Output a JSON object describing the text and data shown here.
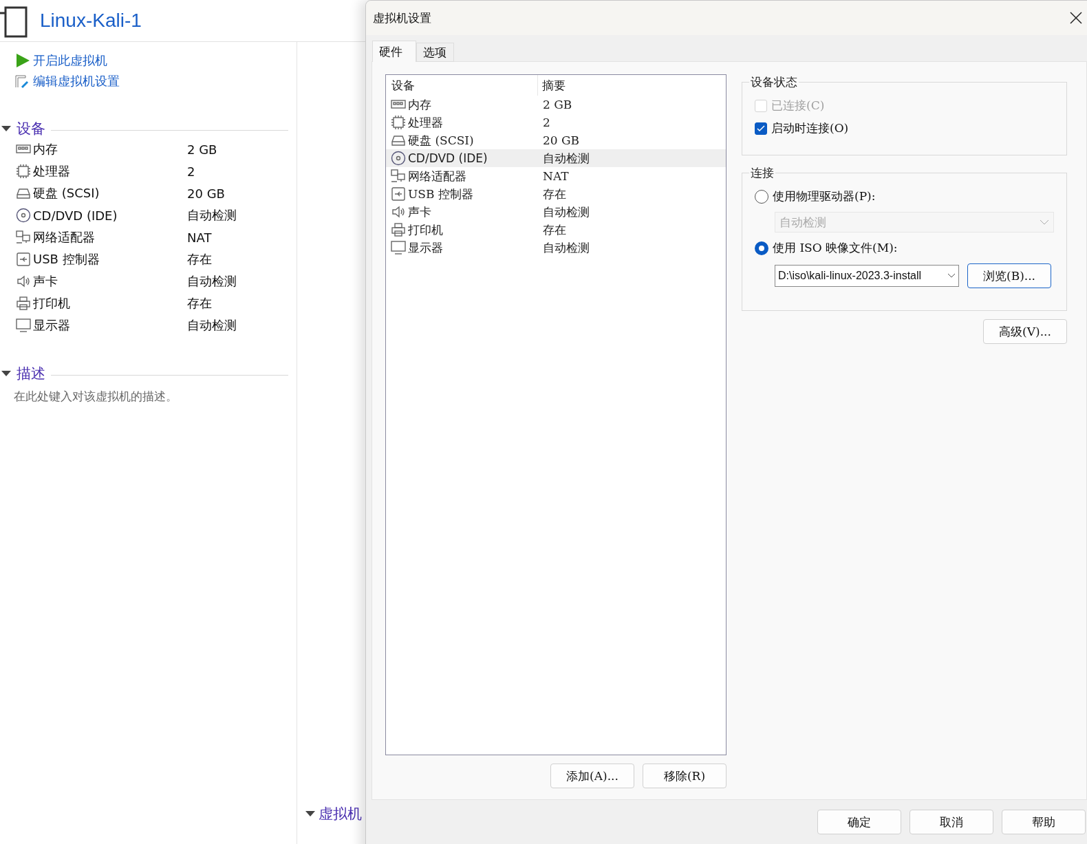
{
  "main_window": {
    "title": "Linux-Kali-1",
    "actions": [
      {
        "kind": "play",
        "label": "开启此虚拟机"
      },
      {
        "kind": "edit",
        "label": "编辑虚拟机设置"
      }
    ],
    "devices_section": {
      "title": "设备",
      "expanded": true,
      "items": [
        {
          "kind": "memory",
          "name": "内存",
          "value": "2 GB"
        },
        {
          "kind": "cpu",
          "name": "处理器",
          "value": "2"
        },
        {
          "kind": "disk",
          "name": "硬盘 (SCSI)",
          "value": "20 GB"
        },
        {
          "kind": "cdrom",
          "name": "CD/DVD (IDE)",
          "value": "自动检测"
        },
        {
          "kind": "network",
          "name": "网络适配器",
          "value": "NAT"
        },
        {
          "kind": "usb",
          "name": "USB 控制器",
          "value": "存在"
        },
        {
          "kind": "sound",
          "name": "声卡",
          "value": "自动检测"
        },
        {
          "kind": "printer",
          "name": "打印机",
          "value": "存在"
        },
        {
          "kind": "display",
          "name": "显示器",
          "value": "自动检测"
        }
      ]
    },
    "description_section": {
      "title": "描述",
      "expanded": true,
      "placeholder": "在此处键入对该虚拟机的描述。"
    },
    "details_section": {
      "title": "虚拟机",
      "expanded": true
    }
  },
  "dialog": {
    "title": "虚拟机设置",
    "tabs": [
      {
        "label": "硬件",
        "selected": true
      },
      {
        "label": "选项",
        "selected": false
      }
    ],
    "device_table": {
      "columns": [
        "设备",
        "摘要"
      ],
      "rows": [
        {
          "kind": "memory",
          "device": "内存",
          "summary": "2 GB",
          "selected": false
        },
        {
          "kind": "cpu",
          "device": "处理器",
          "summary": "2",
          "selected": false
        },
        {
          "kind": "disk",
          "device": "硬盘 (SCSI)",
          "summary": "20 GB",
          "selected": false
        },
        {
          "kind": "cdrom",
          "device": "CD/DVD (IDE)",
          "summary": "自动检测",
          "selected": true
        },
        {
          "kind": "network",
          "device": "网络适配器",
          "summary": "NAT",
          "selected": false
        },
        {
          "kind": "usb",
          "device": "USB 控制器",
          "summary": "存在",
          "selected": false
        },
        {
          "kind": "sound",
          "device": "声卡",
          "summary": "自动检测",
          "selected": false
        },
        {
          "kind": "printer",
          "device": "打印机",
          "summary": "存在",
          "selected": false
        },
        {
          "kind": "display",
          "device": "显示器",
          "summary": "自动检测",
          "selected": false
        }
      ]
    },
    "list_buttons": [
      "添加(A)...",
      "移除(R)"
    ],
    "device_status": {
      "title": "设备状态",
      "checkboxes": [
        {
          "label": "已连接(C)",
          "checked": false,
          "disabled": true
        },
        {
          "label": "启动时连接(O)",
          "checked": true,
          "disabled": false
        }
      ]
    },
    "connection": {
      "title": "连接",
      "physical_drive": {
        "label": "使用物理驱动器(P):",
        "selected": false,
        "dropdown": {
          "value": "自动检测",
          "disabled": true
        }
      },
      "iso_image": {
        "label": "使用 ISO 映像文件(M):",
        "selected": true,
        "path": "D:\\iso\\kali-linux-2023.3-install",
        "browse_button": "浏览(B)..."
      }
    },
    "advanced_button": "高级(V)...",
    "footer_buttons": [
      "确定",
      "取消",
      "帮助"
    ]
  }
}
